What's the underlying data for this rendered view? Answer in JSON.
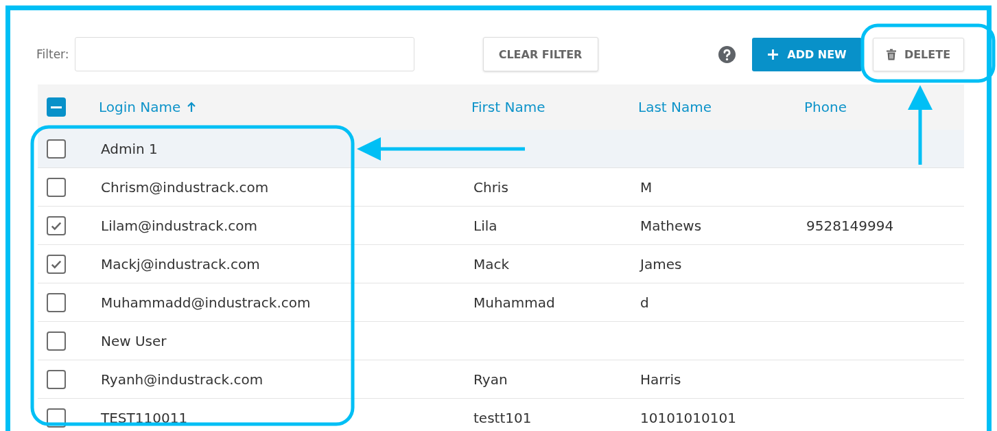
{
  "toolbar": {
    "filter_label": "Filter:",
    "clear_filter": "CLEAR FILTER",
    "add_new": "ADD NEW",
    "delete": "DELETE"
  },
  "table": {
    "select_all_partial": true,
    "columns": [
      {
        "label": "Login Name",
        "sorted": true
      },
      {
        "label": "First Name",
        "sorted": false
      },
      {
        "label": "Last Name",
        "sorted": false
      },
      {
        "label": "Phone",
        "sorted": false
      }
    ],
    "rows": [
      {
        "login_name": "Admin 1",
        "checked": false,
        "highlighted": true
      },
      {
        "login_name": "Chrism@industrack.com",
        "first_name": "Chris",
        "last_name": "M",
        "checked": false,
        "highlighted": false
      },
      {
        "login_name": "Lilam@industrack.com",
        "first_name": "Lila",
        "last_name": "Mathews",
        "phone": "9528149994",
        "checked": true,
        "highlighted": false
      },
      {
        "login_name": "Mackj@industrack.com",
        "first_name": "Mack",
        "last_name": "James",
        "checked": true,
        "highlighted": false
      },
      {
        "login_name": "Muhammadd@industrack.com",
        "first_name": "Muhammad",
        "last_name": "d",
        "checked": false,
        "highlighted": false
      },
      {
        "login_name": "New User",
        "checked": false,
        "highlighted": false
      },
      {
        "login_name": "Ryanh@industrack.com",
        "first_name": "Ryan",
        "last_name": "Harris",
        "checked": false,
        "highlighted": false
      },
      {
        "login_name": "TEST110011",
        "first_name": "testt101",
        "last_name": "10101010101",
        "checked": false,
        "highlighted": false
      }
    ]
  }
}
